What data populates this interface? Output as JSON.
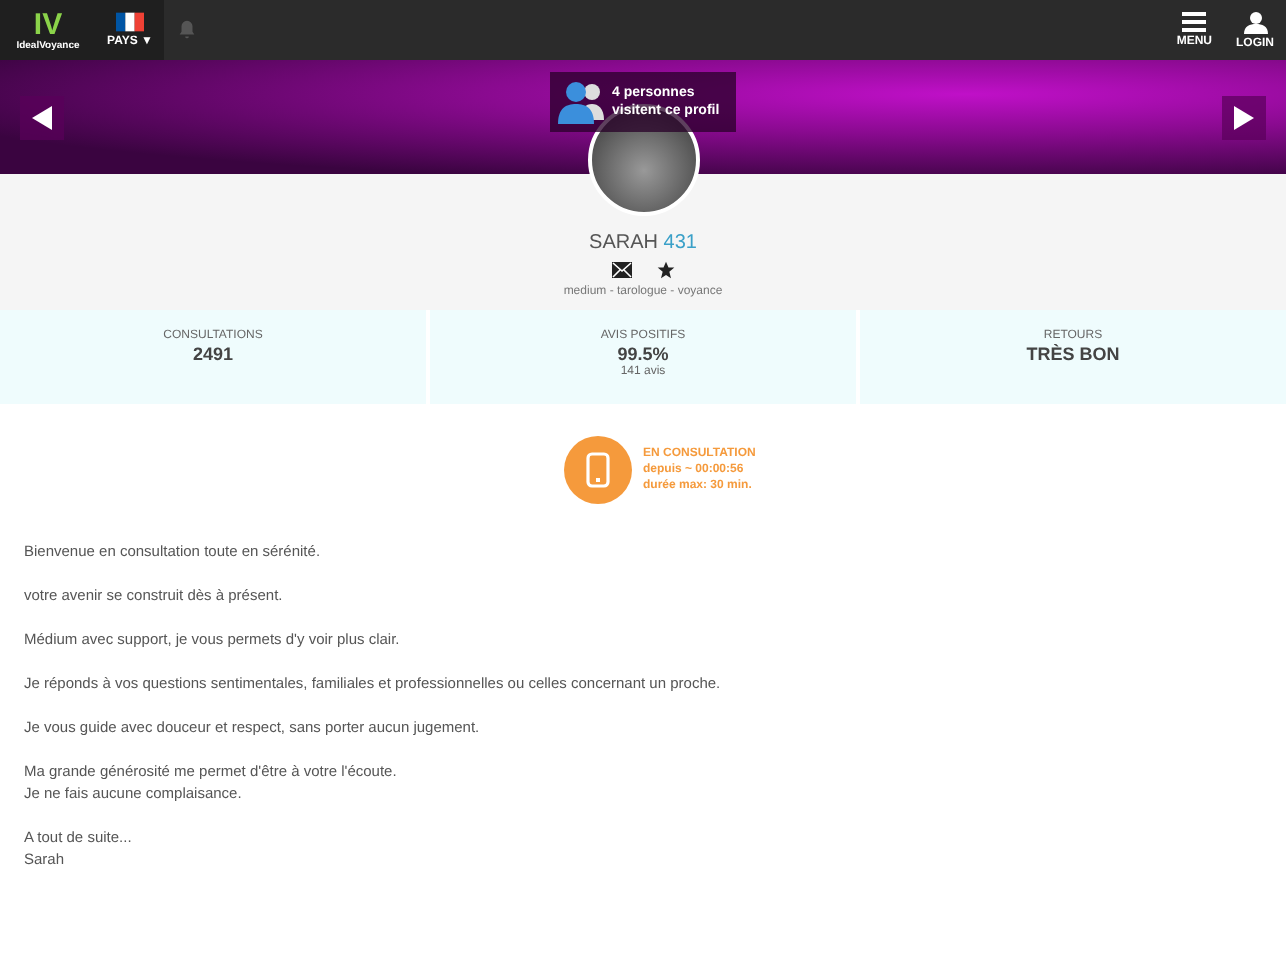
{
  "header": {
    "logo_mark": "IV",
    "logo_name": "IdealVoyance",
    "country": "PAYS ▼",
    "menu": "MENU",
    "login": "LOGIN"
  },
  "banner": {
    "visitors": [
      "4 personnes",
      "visitent ce profil"
    ]
  },
  "profile": {
    "name": "SARAH",
    "number": "431",
    "tags": "medium - tarologue - voyance"
  },
  "stats": [
    {
      "label": "CONSULTATIONS",
      "value": "2491"
    },
    {
      "label": "AVIS POSITIFS",
      "value": "99.5%",
      "note": "141 avis"
    },
    {
      "label": "RETOURS",
      "value": "TRÈS BON"
    }
  ],
  "status": {
    "kind": "busy",
    "title": "EN CONSULTATION",
    "since": "depuis ~ 00:00:56",
    "max": "durée max: 30 min."
  },
  "description": [
    [
      "Bienvenue en consultation toute en sérénité."
    ],
    [
      "votre avenir se construit dès à présent."
    ],
    [
      "Médium avec support, je vous permets d'y voir plus clair."
    ],
    [
      "Je réponds à vos questions sentimentales, familiales et professionnelles ou celles concernant un proche."
    ],
    [
      "Je vous guide avec douceur et respect, sans porter aucun jugement."
    ],
    [
      "Ma grande générosité me permet d'être à votre l'écoute.",
      "Je ne fais aucune complaisance."
    ],
    [
      "A tout de suite...",
      "Sarah"
    ]
  ]
}
